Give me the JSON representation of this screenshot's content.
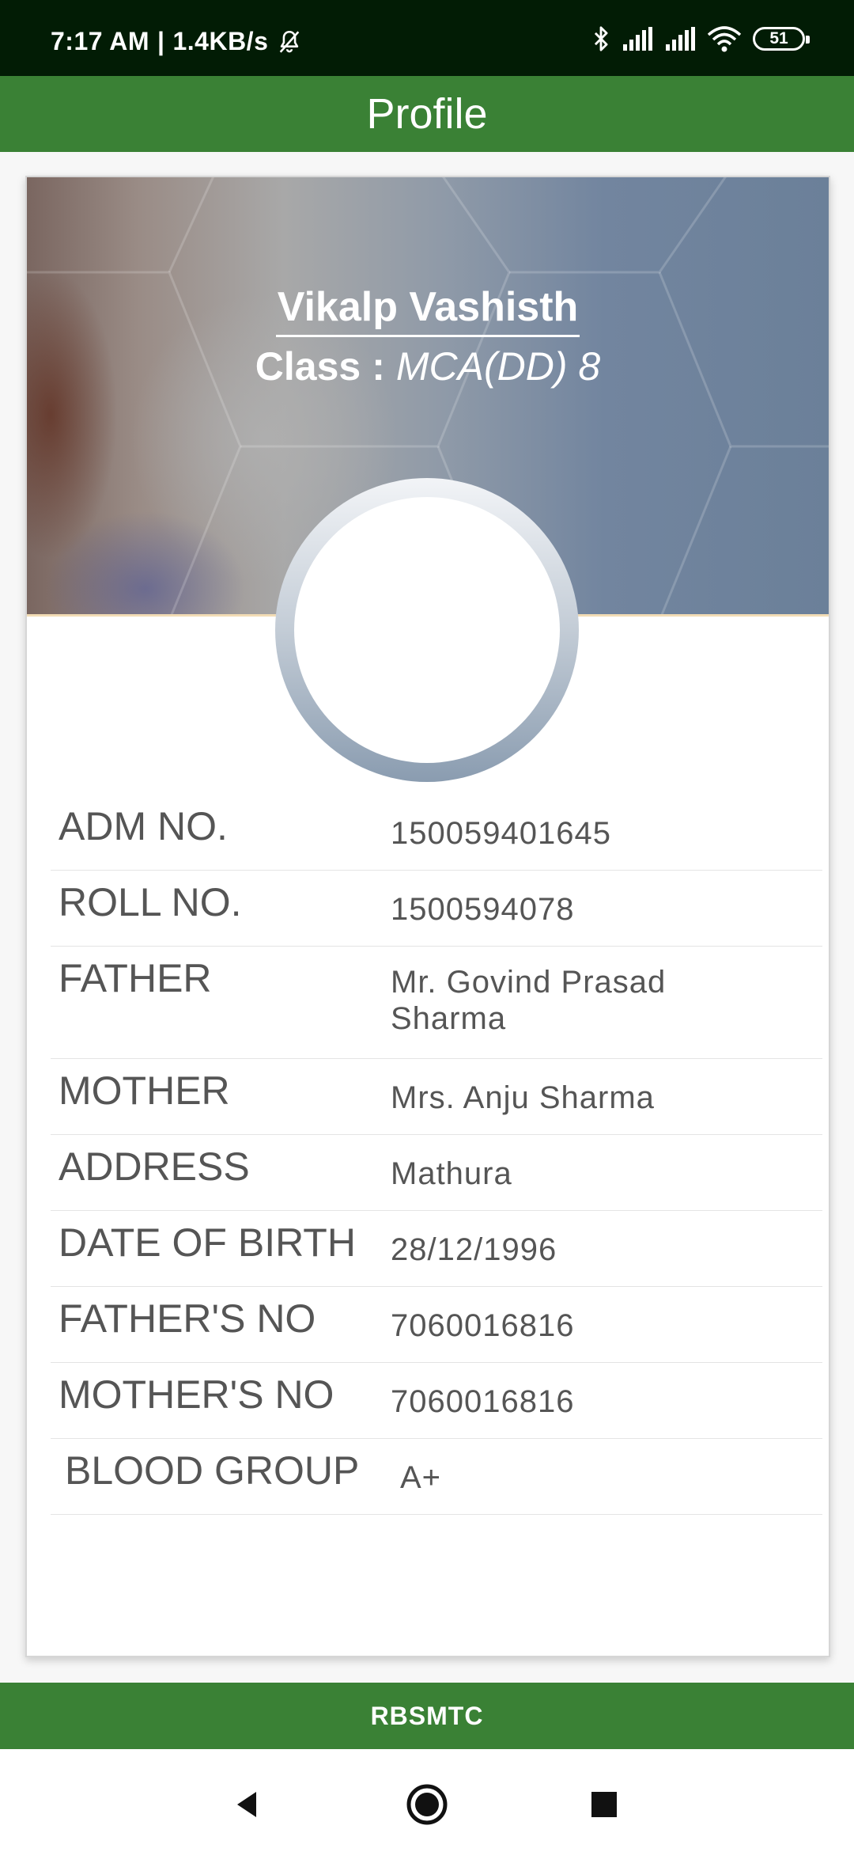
{
  "status_bar": {
    "time": "7:17 AM",
    "separator": "|",
    "data_rate": "1.4KB/s",
    "battery_level": "51",
    "icons": [
      "mute-bell-icon",
      "bluetooth-icon",
      "signal-icon",
      "signal-icon",
      "wifi-icon",
      "battery-icon"
    ]
  },
  "app_bar": {
    "title": "Profile"
  },
  "profile": {
    "name": "Vikalp Vashisth",
    "class_label": "Class",
    "class_separator": ":",
    "class_value": "MCA(DD) 8"
  },
  "details": [
    {
      "label": "ADM NO.",
      "value": "150059401645"
    },
    {
      "label": "ROLL NO.",
      "value": "1500594078"
    },
    {
      "label": "FATHER",
      "value": "Mr. Govind Prasad Sharma"
    },
    {
      "label": "MOTHER",
      "value": "Mrs. Anju Sharma"
    },
    {
      "label": "ADDRESS",
      "value": "Mathura"
    },
    {
      "label": "DATE OF BIRTH",
      "value": "28/12/1996"
    },
    {
      "label": "FATHER'S NO",
      "value": "7060016816"
    },
    {
      "label": "MOTHER'S NO",
      "value": "7060016816"
    },
    {
      "label": "BLOOD GROUP",
      "value": "A+"
    }
  ],
  "footer": {
    "text": "RBSMTC"
  },
  "nav_bar": {
    "icons": [
      "back-triangle-icon",
      "home-circle-icon",
      "recents-square-icon"
    ]
  },
  "colors": {
    "status_bar": "#021c05",
    "primary_green": "#3a8135",
    "text_gray": "#555555"
  }
}
